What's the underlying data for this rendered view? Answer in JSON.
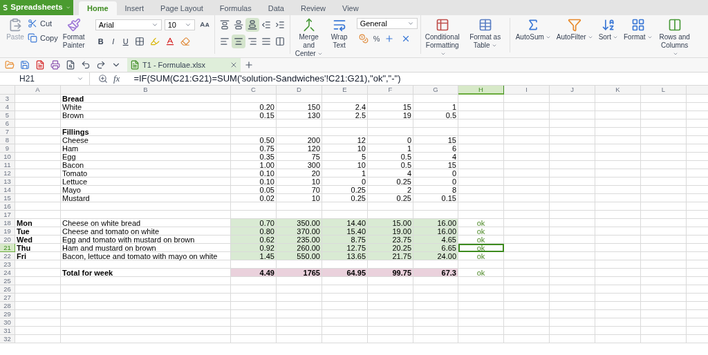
{
  "app_menu": {
    "label": "Spreadsheets"
  },
  "tabs": [
    {
      "label": "Home",
      "selected": true
    },
    {
      "label": "Insert",
      "selected": false
    },
    {
      "label": "Page Layout",
      "selected": false
    },
    {
      "label": "Formulas",
      "selected": false
    },
    {
      "label": "Data",
      "selected": false
    },
    {
      "label": "Review",
      "selected": false
    },
    {
      "label": "View",
      "selected": false
    }
  ],
  "ribbon": {
    "paste": {
      "label": "Paste",
      "disabled": true
    },
    "cut": {
      "label": "Cut"
    },
    "copy": {
      "label": "Copy"
    },
    "format_painter": {
      "label": "Format Painter"
    },
    "font_name": "Arial",
    "font_size": "10",
    "bold": "B",
    "italic": "I",
    "underline": "U",
    "merge": {
      "label": "Merge and Center",
      "dropdown": true
    },
    "wrap": {
      "label": "Wrap Text",
      "dropdown": false
    },
    "number_format": "General",
    "percent": "%",
    "tools": [
      {
        "label": "Conditional Formatting",
        "dropdown": true
      },
      {
        "label": "Format as Table",
        "dropdown": true
      }
    ],
    "editing": [
      {
        "label": "AutoSum",
        "dropdown": true
      },
      {
        "label": "AutoFilter",
        "dropdown": true
      },
      {
        "label": "Sort",
        "dropdown": true
      },
      {
        "label": "Format",
        "dropdown": true
      },
      {
        "label": "Rows and Columns",
        "dropdown": true
      }
    ]
  },
  "document_tab": {
    "label": "T1 - Formulae.xlsx"
  },
  "formula_bar": {
    "name_box": "H21",
    "fx": "fx",
    "formula": "=IF(SUM(C21:G21)=SUM('solution-Sandwiches'!C21:G21),\"ok\",\"-\")"
  },
  "sheet": {
    "columns": [
      {
        "label": "A",
        "selected": false
      },
      {
        "label": "B",
        "selected": false
      },
      {
        "label": "C",
        "selected": false
      },
      {
        "label": "D",
        "selected": false
      },
      {
        "label": "E",
        "selected": false
      },
      {
        "label": "F",
        "selected": false
      },
      {
        "label": "G",
        "selected": false
      },
      {
        "label": "H",
        "selected": true
      },
      {
        "label": "I",
        "selected": false
      },
      {
        "label": "J",
        "selected": false
      },
      {
        "label": "K",
        "selected": false
      },
      {
        "label": "L",
        "selected": false
      }
    ],
    "rows": [
      {
        "number": "3",
        "selected": false,
        "kind": "heading",
        "cells": {
          "B": "Bread"
        }
      },
      {
        "number": "4",
        "selected": false,
        "kind": "item",
        "cells": {
          "B": "White",
          "C": "0.20",
          "D": "150",
          "E": "2.4",
          "F": "15",
          "G": "1"
        }
      },
      {
        "number": "5",
        "selected": false,
        "kind": "item",
        "cells": {
          "B": "Brown",
          "C": "0.15",
          "D": "130",
          "E": "2.5",
          "F": "19",
          "G": "0.5"
        }
      },
      {
        "number": "6",
        "selected": false,
        "kind": "item",
        "cells": {}
      },
      {
        "number": "7",
        "selected": false,
        "kind": "heading",
        "cells": {
          "B": "Fillings"
        }
      },
      {
        "number": "8",
        "selected": false,
        "kind": "item",
        "cells": {
          "B": "Cheese",
          "C": "0.50",
          "D": "200",
          "E": "12",
          "F": "0",
          "G": "15"
        }
      },
      {
        "number": "9",
        "selected": false,
        "kind": "item",
        "cells": {
          "B": "Ham",
          "C": "0.75",
          "D": "120",
          "E": "10",
          "F": "1",
          "G": "6"
        }
      },
      {
        "number": "10",
        "selected": false,
        "kind": "item",
        "cells": {
          "B": "Egg",
          "C": "0.35",
          "D": "75",
          "E": "5",
          "F": "0.5",
          "G": "4"
        }
      },
      {
        "number": "11",
        "selected": false,
        "kind": "item",
        "cells": {
          "B": "Bacon",
          "C": "1.00",
          "D": "300",
          "E": "10",
          "F": "0.5",
          "G": "15"
        }
      },
      {
        "number": "12",
        "selected": false,
        "kind": "item",
        "cells": {
          "B": "Tomato",
          "C": "0.10",
          "D": "20",
          "E": "1",
          "F": "4",
          "G": "0"
        }
      },
      {
        "number": "13",
        "selected": false,
        "kind": "item",
        "cells": {
          "B": "Lettuce",
          "C": "0.10",
          "D": "10",
          "E": "0",
          "F": "0.25",
          "G": "0"
        }
      },
      {
        "number": "14",
        "selected": false,
        "kind": "item",
        "cells": {
          "B": "Mayo",
          "C": "0.05",
          "D": "70",
          "E": "0.25",
          "F": "2",
          "G": "8"
        }
      },
      {
        "number": "15",
        "selected": false,
        "kind": "item",
        "cells": {
          "B": "Mustard",
          "C": "0.02",
          "D": "10",
          "E": "0.25",
          "F": "0.25",
          "G": "0.15"
        }
      },
      {
        "number": "16",
        "selected": false,
        "kind": "item",
        "cells": {}
      },
      {
        "number": "17",
        "selected": false,
        "kind": "item",
        "cells": {}
      },
      {
        "number": "18",
        "selected": false,
        "kind": "day",
        "cells": {
          "A": "Mon",
          "B": "Cheese on white bread",
          "C": "0.70",
          "D": "350.00",
          "E": "14.40",
          "F": "15.00",
          "G": "16.00",
          "H": "ok"
        }
      },
      {
        "number": "19",
        "selected": false,
        "kind": "day",
        "cells": {
          "A": "Tue",
          "B": "Cheese and tomato on white",
          "C": "0.80",
          "D": "370.00",
          "E": "15.40",
          "F": "19.00",
          "G": "16.00",
          "H": "ok"
        }
      },
      {
        "number": "20",
        "selected": false,
        "kind": "day",
        "cells": {
          "A": "Wed",
          "B": "Egg and tomato with mustard on brown",
          "C": "0.62",
          "D": "235.00",
          "E": "8.75",
          "F": "23.75",
          "G": "4.65",
          "H": "ok"
        }
      },
      {
        "number": "21",
        "selected": true,
        "kind": "day",
        "cells": {
          "A": "Thu",
          "B": "Ham and mustard on brown",
          "C": "0.92",
          "D": "260.00",
          "E": "12.75",
          "F": "20.25",
          "G": "6.65",
          "H": "ok"
        }
      },
      {
        "number": "22",
        "selected": false,
        "kind": "day",
        "cells": {
          "A": "Fri",
          "B": "Bacon, lettuce and tomato with mayo on white",
          "C": "1.45",
          "D": "550.00",
          "E": "13.65",
          "F": "21.75",
          "G": "24.00",
          "H": "ok"
        }
      },
      {
        "number": "23",
        "selected": false,
        "kind": "item",
        "cells": {}
      },
      {
        "number": "24",
        "selected": false,
        "kind": "total",
        "cells": {
          "B": "Total for week",
          "C": "4.49",
          "D": "1765",
          "E": "64.95",
          "F": "99.75",
          "G": "67.3",
          "H": "ok"
        }
      },
      {
        "number": "25",
        "selected": false,
        "kind": "item",
        "cells": {}
      },
      {
        "number": "26",
        "selected": false,
        "kind": "item",
        "cells": {}
      },
      {
        "number": "27",
        "selected": false,
        "kind": "item",
        "cells": {}
      },
      {
        "number": "28",
        "selected": false,
        "kind": "item",
        "cells": {}
      },
      {
        "number": "29",
        "selected": false,
        "kind": "item",
        "cells": {}
      },
      {
        "number": "30",
        "selected": false,
        "kind": "item",
        "cells": {}
      },
      {
        "number": "31",
        "selected": false,
        "kind": "item",
        "cells": {}
      },
      {
        "number": "32",
        "selected": false,
        "kind": "item",
        "cells": {}
      }
    ]
  }
}
